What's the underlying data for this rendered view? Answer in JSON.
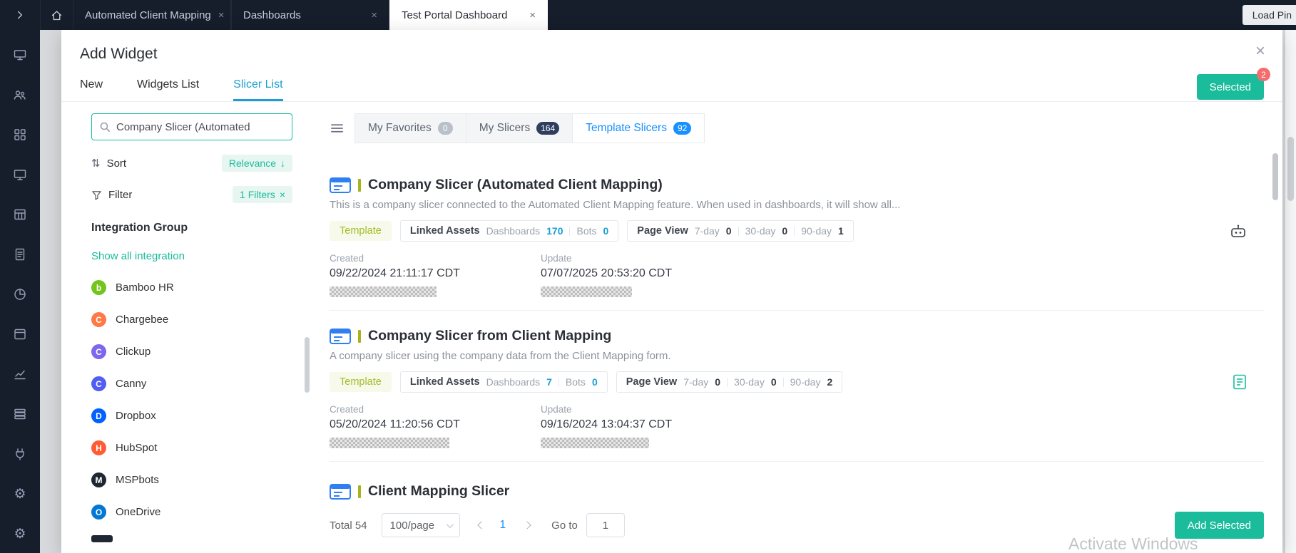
{
  "colors": {
    "accent_teal": "#1abc9c",
    "tab_blue": "#1a9fd0",
    "list_tab_blue": "#1890ff",
    "navy": "#161d2b",
    "badge_red": "#f56c6c",
    "template_lime": "#a2bd2a"
  },
  "topbar": {
    "tabs": [
      {
        "label": "Automated Client Mapping"
      },
      {
        "label": "Dashboards"
      },
      {
        "label": "Test Portal Dashboard"
      }
    ],
    "load_pin_label": "Load Pin"
  },
  "sidebar_icons": [
    "billboard",
    "team",
    "apps-grid",
    "monitor",
    "table",
    "document",
    "pie-chart",
    "window",
    "line-chart",
    "rows",
    "plug",
    "settings",
    "gear"
  ],
  "modal": {
    "title": "Add Widget",
    "tabs": {
      "new": "New",
      "widgets": "Widgets List",
      "slicers": "Slicer List"
    },
    "selected_button": {
      "label": "Selected",
      "badge": "2"
    },
    "sidebar": {
      "search_value": "Company Slicer (Automated",
      "sort_label": "Sort",
      "sort_value": "Relevance",
      "filter_label": "Filter",
      "filter_value": "1 Filters",
      "group_heading": "Integration Group",
      "show_all": "Show all integration",
      "integrations": [
        {
          "name": "Bamboo HR",
          "initial": "b",
          "color": "#73c41d"
        },
        {
          "name": "Chargebee",
          "initial": "C",
          "color": "#ff7846"
        },
        {
          "name": "Clickup",
          "initial": "C",
          "color": "#7b68ee"
        },
        {
          "name": "Canny",
          "initial": "C",
          "color": "#525df4"
        },
        {
          "name": "Dropbox",
          "initial": "D",
          "color": "#0061ff"
        },
        {
          "name": "HubSpot",
          "initial": "H",
          "color": "#ff5c35"
        },
        {
          "name": "MSPbots",
          "initial": "M",
          "color": "#1f2733"
        },
        {
          "name": "OneDrive",
          "initial": "O",
          "color": "#0078d4"
        }
      ]
    },
    "list": {
      "tabs": [
        {
          "label": "My Favorites",
          "count": "0"
        },
        {
          "label": "My Slicers",
          "count": "164"
        },
        {
          "label": "Template Slicers",
          "count": "92"
        }
      ],
      "labels": {
        "template": "Template",
        "linked_assets": "Linked Assets",
        "dashboards": "Dashboards",
        "bots": "Bots",
        "page_view": "Page View",
        "d7": "7-day",
        "d30": "30-day",
        "d90": "90-day",
        "created": "Created",
        "update": "Update"
      },
      "cards": [
        {
          "title": "Company Slicer (Automated Client Mapping)",
          "description": "This is a company slicer connected to the Automated Client Mapping feature. When used in dashboards, it will show all...",
          "dashboards_count": "170",
          "bots_count": "0",
          "d7": "0",
          "d30": "0",
          "d90": "1",
          "created": "09/22/2024 21:11:17 CDT",
          "updated": "07/07/2025 20:53:20 CDT"
        },
        {
          "title": "Company Slicer from Client Mapping",
          "description": "A company slicer using the company data from the Client Mapping form.",
          "dashboards_count": "7",
          "bots_count": "0",
          "d7": "0",
          "d30": "0",
          "d90": "2",
          "created": "05/20/2024 11:20:56 CDT",
          "updated": "09/16/2024 13:04:37 CDT"
        },
        {
          "title": "Client Mapping Slicer"
        }
      ],
      "pagination": {
        "total": "Total 54",
        "page_size": "100/page",
        "page": "1",
        "goto_label": "Go to",
        "goto_value": "1",
        "add_button": "Add Selected"
      }
    }
  },
  "watermark": "Activate Windows"
}
